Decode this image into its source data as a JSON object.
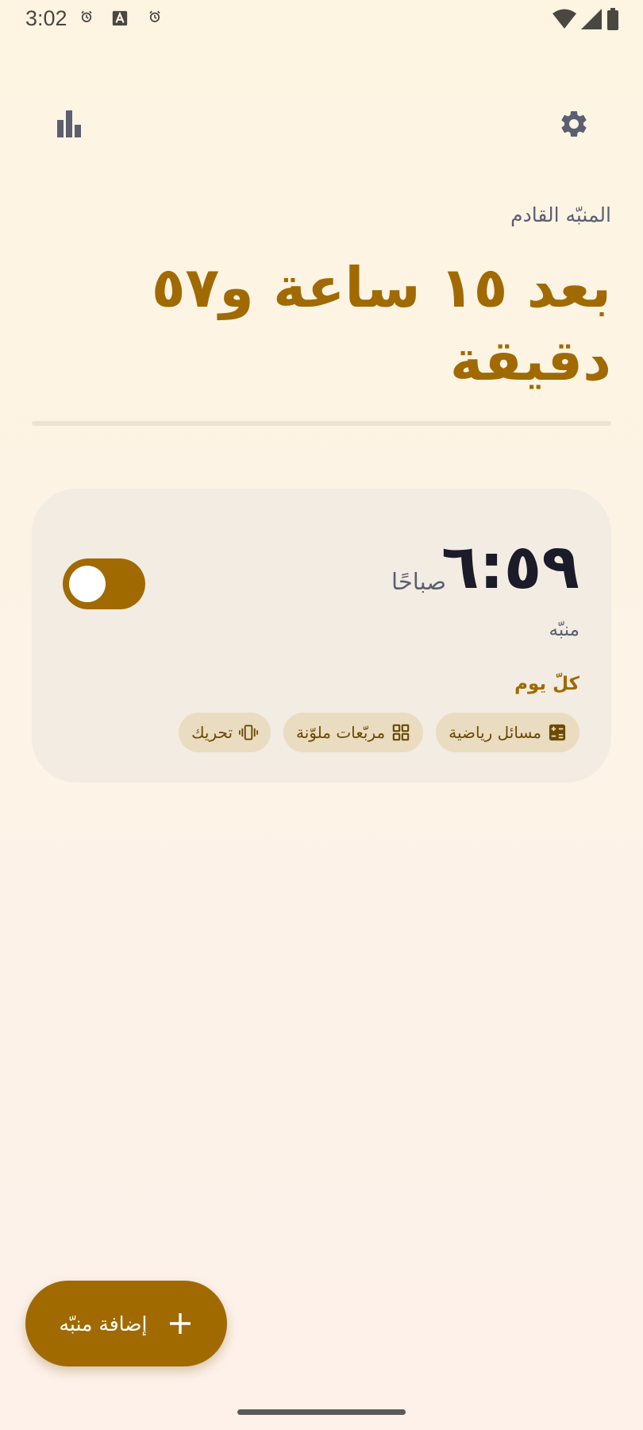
{
  "status_bar": {
    "time": "3:02",
    "notification_icons": [
      "alarm-clock-icon",
      "text-a-icon",
      "alarm-clock-icon"
    ],
    "system_icons": [
      "wifi-icon",
      "signal-icon",
      "battery-icon"
    ]
  },
  "toolbar": {
    "stats_icon": "bar-chart-icon",
    "settings_icon": "gear-icon"
  },
  "next_alarm": {
    "label": "المنبّه القادم",
    "value": "بعد ١٥ ساعة و٥٧ دقيقة",
    "progress": 0.0
  },
  "alarm": {
    "time": "٦:٥٩",
    "ampm": "صباحًا",
    "label": "منبّه",
    "repeat": "كلّ يوم",
    "enabled": true,
    "chips": [
      {
        "label": "مسائل رياضية",
        "icon": "calculator-icon"
      },
      {
        "label": "مربّعات ملوّنة",
        "icon": "grid-icon"
      },
      {
        "label": "تحريك",
        "icon": "vibrate-icon"
      }
    ]
  },
  "fab": {
    "label": "إضافة منبّه",
    "icon": "plus-icon"
  },
  "colors": {
    "accent": "#a06a00",
    "card_background": "#f2ece3",
    "chip_background": "#eadcc1",
    "secondary_text": "#5c5f70"
  }
}
